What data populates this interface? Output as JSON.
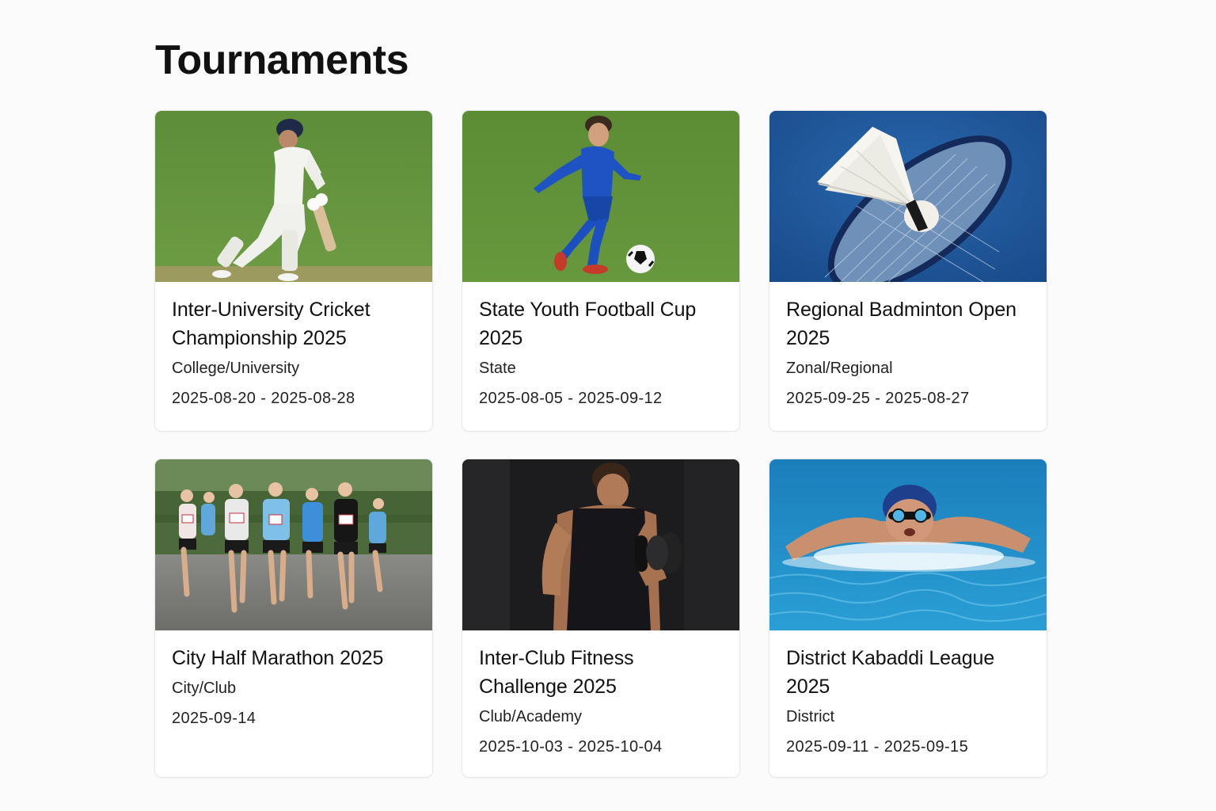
{
  "page": {
    "title": "Tournaments"
  },
  "tournaments": [
    {
      "title": "Inter-University Cricket Championship 2025",
      "level": "College/University",
      "dates": "2025-08-20 - 2025-08-28",
      "image": "cricket-batsman-photo"
    },
    {
      "title": "State Youth Football Cup 2025",
      "level": "State",
      "dates": "2025-08-05 - 2025-09-12",
      "image": "youth-football-player-photo"
    },
    {
      "title": "Regional Badminton Open 2025",
      "level": "Zonal/Regional",
      "dates": "2025-09-25 - 2025-08-27",
      "image": "shuttlecock-racket-photo"
    },
    {
      "title": "City Half Marathon 2025",
      "level": "City/Club",
      "dates": "2025-09-14",
      "image": "marathon-runners-photo"
    },
    {
      "title": "Inter-Club Fitness Challenge 2025",
      "level": "Club/Academy",
      "dates": "2025-10-03  - 2025-10-04",
      "image": "dumbbell-curl-photo"
    },
    {
      "title": "District Kabaddi League 2025",
      "level": "District",
      "dates": "2025-09-11 - 2025-09-15",
      "image": "swimmer-butterfly-photo"
    }
  ],
  "colors": {
    "background": "#fbfbfb",
    "card": "#ffffff",
    "border": "#e7e7e7",
    "text": "#111111"
  }
}
